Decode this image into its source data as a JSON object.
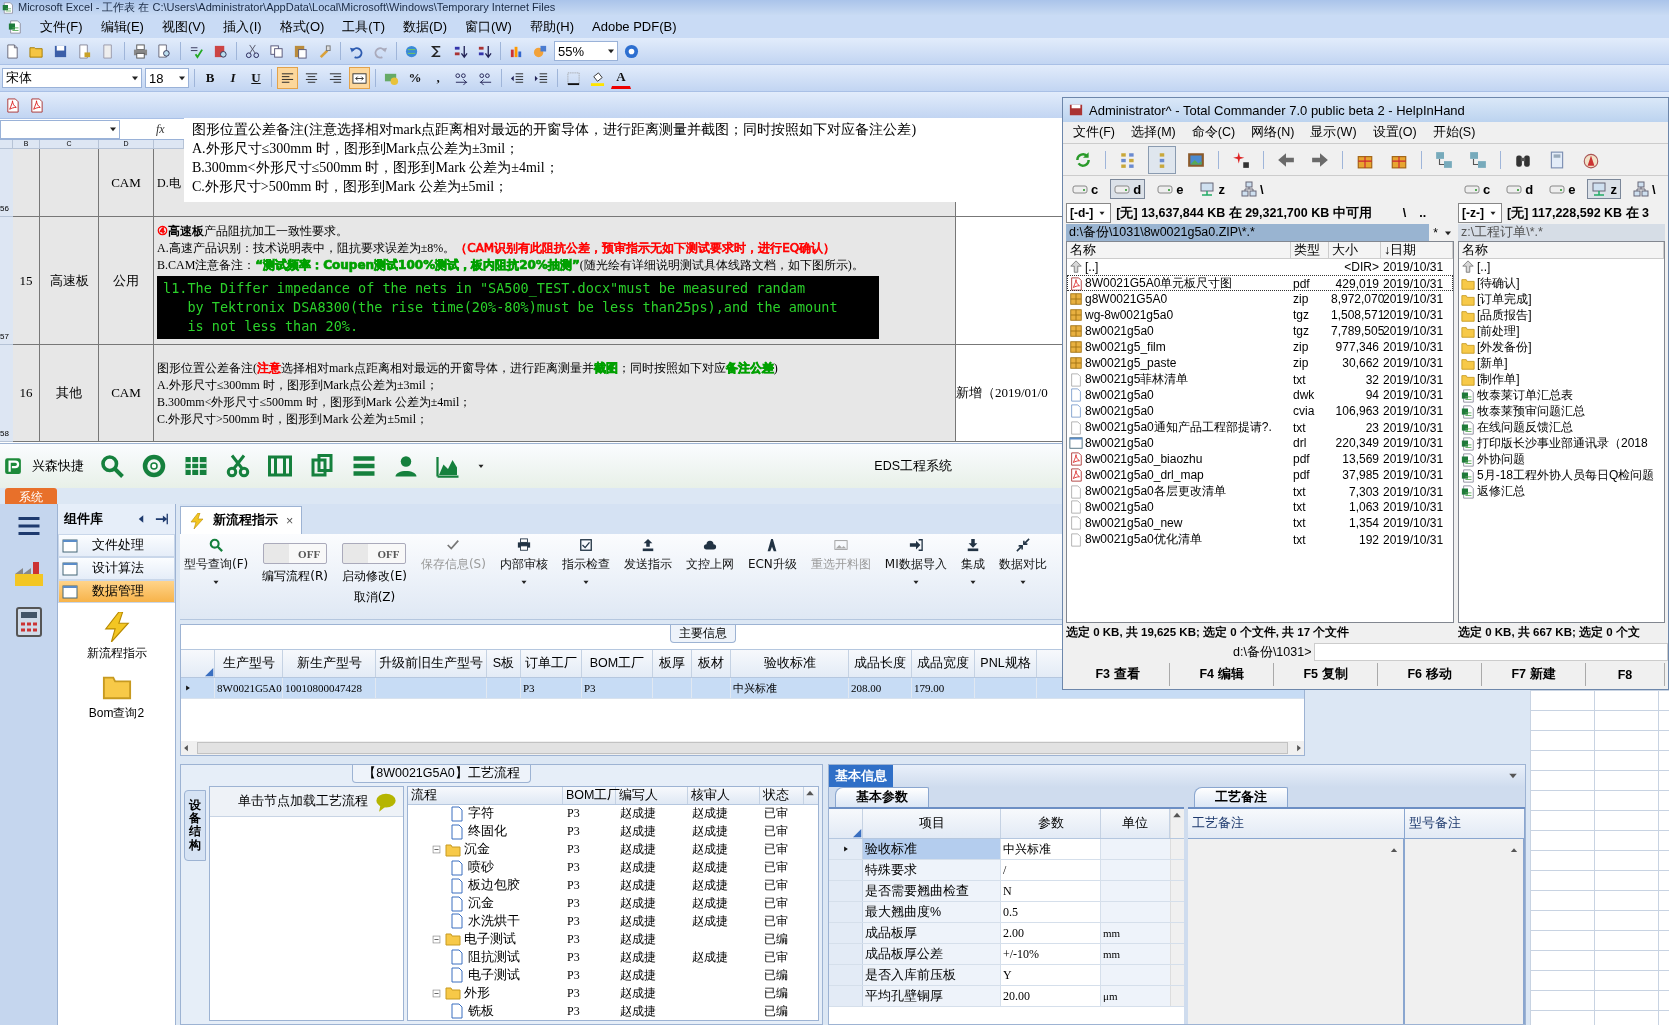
{
  "excel": {
    "title": "Microsoft Excel - 工作表 在 C:\\Users\\Administrator\\AppData\\Local\\Microsoft\\Windows\\Temporary Internet Files",
    "menu": [
      "文件(F)",
      "编辑(E)",
      "视图(V)",
      "插入(I)",
      "格式(O)",
      "工具(T)",
      "数据(D)",
      "窗口(W)",
      "帮助(H)",
      "Adobe PDF(B)"
    ],
    "zoom": "55%",
    "font": "宋体",
    "font_size": "18",
    "format_buttons": [
      {
        "label": "B",
        "kind": "bold"
      },
      {
        "label": "I",
        "kind": "italic"
      },
      {
        "label": "U",
        "kind": "underline"
      }
    ],
    "align_buttons": [
      {
        "kind": "left",
        "selected": true
      },
      {
        "kind": "center",
        "selected": false
      },
      {
        "kind": "right",
        "selected": false
      },
      {
        "kind": "merge",
        "selected": true
      }
    ],
    "number_buttons": [
      "%",
      ","
    ],
    "font_color_label": "A",
    "function_label": "fx",
    "formula_lines": [
      "图形位置公差备注(注意选择相对mark点距离相对最远的开窗导体，进行距离测量并截图；同时按照如下对应备注公差)",
      "A.外形尺寸≤300mm 时，图形到Mark点公差为±3mil；",
      "B.300mm<外形尺寸≤500mm 时，图形到Mark 公差为±4mil；",
      "C.外形尺寸>500mm 时，图形到Mark 公差为±5mil；"
    ],
    "columns": [
      "B",
      "C",
      "D"
    ],
    "rows": [
      {
        "number": "56",
        "owner": "CAM",
        "content": [
          [
            {
              "text": "D.电"
            }
          ]
        ]
      },
      {
        "number": "57",
        "no": "15",
        "category": "高速板",
        "owner": "公用",
        "content": [
          [
            {
              "text": "④",
              "color": "#ff0000"
            },
            {
              "text": "高速板",
              "bold": true
            },
            {
              "text": "产品阻抗加工一致性要求。"
            }
          ],
          [
            {
              "text": "A.高速产品识别：技术说明表中，阻抗要求误差为±8%。"
            },
            {
              "text": "（CAM识别有此阻抗公差，预审指示无如下测试要求时，进行EQ确认）",
              "color": "#ff0000"
            }
          ],
          [
            {
              "text": "B.CAM注意备注："
            },
            {
              "text": "“测试频率：Coupen测试100%测试，板内阻抗20%抽测”",
              "color": "#00a000",
              "bold": true
            },
            {
              "text": "(随光绘有详细说明测试具体线路文档，如下图所示)。"
            }
          ]
        ],
        "console": [
          "l1.The Differ impedance of the nets in \"SA500_TEST.docx\"must be measured randam",
          "   by Tektronix DSA8300(the rise time(20%-80%)must be less than25ps),and the amount",
          "   is not less than 20%."
        ]
      },
      {
        "number": "58",
        "no": "16",
        "category": "其他",
        "owner": "CAM",
        "content": [
          [
            {
              "text": "图形位置公差备注("
            },
            {
              "text": "注意",
              "color": "#ff0000"
            },
            {
              "text": "选择相对mark点距离相对最远的开窗导体，进行距离测量并"
            },
            {
              "text": "截图",
              "color": "#00a000",
              "bold": true
            },
            {
              "text": "；同时按照如下对应"
            },
            {
              "text": "备注公差",
              "color": "#00a000",
              "bold": true
            },
            {
              "text": ")"
            }
          ],
          [
            {
              "text": "A.外形尺寸≤300mm 时，图形到Mark点公差为±3mil；"
            }
          ],
          [
            {
              "text": "B.300mm<外形尺寸≤500mm 时，图形到Mark 公差为±4mil；"
            }
          ],
          [
            {
              "text": "C.外形尺寸>500mm 时，图形到Mark 公差为±5mil；"
            }
          ]
        ],
        "note": "新增（2019/01/0"
      }
    ]
  },
  "tc": {
    "title": "Administrator^ - Total Commander 7.0 public beta 2 - HelpInHand",
    "menu": [
      "文件(F)",
      "选择(M)",
      "命令(C)",
      "网络(N)",
      "显示(W)",
      "设置(O)",
      "开始(S)"
    ],
    "panels": [
      {
        "active": true,
        "drives": [
          {
            "letter": "c",
            "kind": "disk",
            "selected": false
          },
          {
            "letter": "d",
            "kind": "disk",
            "selected": true
          },
          {
            "letter": "e",
            "kind": "disk",
            "selected": false
          },
          {
            "letter": "z",
            "kind": "net",
            "selected": false
          },
          {
            "letter": "\\",
            "kind": "network",
            "selected": false
          }
        ],
        "combo": "[-d-]",
        "free_space": "[无] 13,637,844 KB 在 29,321,700 KB 中可用",
        "nav": [
          "\\",
          ".."
        ],
        "path": "d:\\备份\\1031\\8w0021g5a0.ZIP\\*.*",
        "filter": "*",
        "columns": [
          "名称",
          "类型",
          "大小",
          "↓日期"
        ],
        "files": [
          {
            "name": "[..]",
            "kind": "up",
            "size": "<DIR>",
            "date": "2019/10/31",
            "focused": false
          },
          {
            "name": "8W0021G5A0单元板尺寸图",
            "kind": "pdf",
            "type": "pdf",
            "size": "429,019",
            "date": "2019/10/31",
            "focused": true
          },
          {
            "name": "g8W0021G5A0",
            "kind": "archive",
            "type": "zip",
            "size": "8,972,070",
            "date": "2019/10/31",
            "focused": false
          },
          {
            "name": "wg-8w0021g5a0",
            "kind": "archive",
            "type": "tgz",
            "size": "1,508,571",
            "date": "2019/10/31",
            "focused": false
          },
          {
            "name": "8w0021g5a0",
            "kind": "archive",
            "type": "tgz",
            "size": "7,789,505",
            "date": "2019/10/31",
            "focused": false
          },
          {
            "name": "8w0021g5_film",
            "kind": "archive",
            "type": "zip",
            "size": "977,346",
            "date": "2019/10/31",
            "focused": false
          },
          {
            "name": "8w0021g5_paste",
            "kind": "archive",
            "type": "zip",
            "size": "30,662",
            "date": "2019/10/31",
            "focused": false
          },
          {
            "name": "8w0021g5菲林清单",
            "kind": "text",
            "type": "txt",
            "size": "32",
            "date": "2019/10/31",
            "focused": false
          },
          {
            "name": "8w0021g5a0",
            "kind": "file",
            "type": "dwk",
            "size": "94",
            "date": "2019/10/31",
            "focused": false
          },
          {
            "name": "8w0021g5a0",
            "kind": "file",
            "type": "cvia",
            "size": "106,963",
            "date": "2019/10/31",
            "focused": false
          },
          {
            "name": "8w0021g5a0通知产品工程部提请?.",
            "kind": "text",
            "type": "txt",
            "size": "23",
            "date": "2019/10/31",
            "focused": false
          },
          {
            "name": "8w0021g5a0",
            "kind": "window",
            "type": "drl",
            "size": "220,349",
            "date": "2019/10/31",
            "focused": false
          },
          {
            "name": "8w0021g5a0_biaozhu",
            "kind": "pdf",
            "type": "pdf",
            "size": "13,569",
            "date": "2019/10/31",
            "focused": false
          },
          {
            "name": "8w0021g5a0_drl_map",
            "kind": "pdf",
            "type": "pdf",
            "size": "37,985",
            "date": "2019/10/31",
            "focused": false
          },
          {
            "name": "8w0021g5a0各层更改清单",
            "kind": "text",
            "type": "txt",
            "size": "7,303",
            "date": "2019/10/31",
            "focused": false
          },
          {
            "name": "8w0021g5a0",
            "kind": "text",
            "type": "txt",
            "size": "1,063",
            "date": "2019/10/31",
            "focused": false
          },
          {
            "name": "8w0021g5a0_new",
            "kind": "text",
            "type": "txt",
            "size": "1,354",
            "date": "2019/10/31",
            "focused": false
          },
          {
            "name": "8w0021g5a0优化清单",
            "kind": "text",
            "type": "txt",
            "size": "192",
            "date": "2019/10/31",
            "focused": false
          }
        ],
        "status": "选定 0 KB, 共 19,625 KB; 选定 0 个文件, 共 17 个文件"
      },
      {
        "active": false,
        "drives": [
          {
            "letter": "c",
            "kind": "disk",
            "selected": false
          },
          {
            "letter": "d",
            "kind": "disk",
            "selected": false
          },
          {
            "letter": "e",
            "kind": "disk",
            "selected": false
          },
          {
            "letter": "z",
            "kind": "net",
            "selected": true
          },
          {
            "letter": "\\",
            "kind": "network",
            "selected": false
          }
        ],
        "combo": "[-z-]",
        "free_space": "[无] 117,228,592 KB 在 3",
        "path": "z:\\工程订单\\*.*",
        "columns": [
          "名称"
        ],
        "files": [
          {
            "name": "[..]",
            "kind": "up",
            "focused": false
          },
          {
            "name": "[待确认]",
            "kind": "folder",
            "focused": false
          },
          {
            "name": "[订单完成]",
            "kind": "folder",
            "focused": false
          },
          {
            "name": "[品质报告]",
            "kind": "folder",
            "focused": false
          },
          {
            "name": "[前处理]",
            "kind": "folder",
            "focused": false
          },
          {
            "name": "[外发备份]",
            "kind": "folder",
            "focused": false
          },
          {
            "name": "[新单]",
            "kind": "folder",
            "focused": false
          },
          {
            "name": "[制作单]",
            "kind": "folder",
            "focused": false
          },
          {
            "name": "牧泰莱订单汇总表",
            "kind": "sheet",
            "focused": false
          },
          {
            "name": "牧泰莱预审问题汇总",
            "kind": "sheet",
            "focused": false
          },
          {
            "name": "在线问题反馈汇总",
            "kind": "sheet",
            "focused": false
          },
          {
            "name": "打印版长沙事业部通讯录（2018",
            "kind": "sheet",
            "focused": false
          },
          {
            "name": "外协问题",
            "kind": "sheet",
            "focused": false
          },
          {
            "name": "5月-18工程外协人员每日Q检问题",
            "kind": "sheet",
            "focused": false
          },
          {
            "name": "返修汇总",
            "kind": "sheet",
            "focused": false
          }
        ],
        "status": "选定 0 KB, 共 667 KB; 选定 0 个文"
      }
    ],
    "command_prompt": "d:\\备份\\1031>",
    "function_keys": [
      "F3 查看",
      "F4 编辑",
      "F5 复制",
      "F6 移动",
      "F7 新建",
      "F8"
    ]
  },
  "eds": {
    "brand": "兴森快捷",
    "title": "EDS工程系统",
    "system_tab": "系统",
    "sidebar": {
      "title": "组件库",
      "items": [
        {
          "label": "文件处理",
          "selected": false
        },
        {
          "label": "设计算法",
          "selected": false
        },
        {
          "label": "数据管理",
          "selected": true
        }
      ],
      "launchers": [
        {
          "label": "新流程指示",
          "kind": "bolt"
        },
        {
          "label": "Bom查询2",
          "kind": "folder"
        }
      ]
    },
    "doc_tabs": [
      {
        "label": "新流程指示",
        "close_label": "×",
        "selected": true
      }
    ],
    "ribbon": [
      {
        "kind": "button",
        "label": "型号查询(F)",
        "disabled": false,
        "dropdown": true
      },
      {
        "kind": "toggle",
        "label": "编写流程(R)",
        "switch_text": "OFF",
        "on": false
      },
      {
        "kind": "toggle",
        "label": "启动修改(E)",
        "sublabel": "取消(Z)",
        "switch_text": "OFF",
        "on": false
      },
      {
        "kind": "button",
        "label": "保存信息(S)",
        "disabled": true,
        "dropdown": false
      },
      {
        "kind": "button",
        "label": "内部审核",
        "disabled": false,
        "dropdown": true
      },
      {
        "kind": "button",
        "label": "指示检查",
        "disabled": false,
        "dropdown": true
      },
      {
        "kind": "button",
        "label": "发送指示",
        "disabled": false,
        "dropdown": false
      },
      {
        "kind": "button",
        "label": "文控上网",
        "disabled": false,
        "dropdown": false
      },
      {
        "kind": "button",
        "label": "ECN升级",
        "disabled": false,
        "dropdown": false
      },
      {
        "kind": "button",
        "label": "重选开料图",
        "disabled": true,
        "dropdown": false
      },
      {
        "kind": "button",
        "label": "MI数据导入",
        "disabled": false,
        "dropdown": true
      },
      {
        "kind": "button",
        "label": "集成",
        "disabled": false,
        "dropdown": true
      },
      {
        "kind": "button",
        "label": "数据对比",
        "disabled": false,
        "dropdown": true
      }
    ],
    "grid": {
      "group": "主要信息",
      "columns": [
        "生产型号",
        "新生产型号",
        "升级前旧生产型号",
        "S板",
        "订单工厂",
        "BOM工厂",
        "板厚",
        "板材",
        "验收标准",
        "成品长度",
        "成品宽度",
        "PNL规格"
      ],
      "rows": [
        {
          "selected": true,
          "cells": [
            "8W0021G5A0",
            "10010800047428",
            null,
            null,
            "P3",
            "P3",
            null,
            null,
            "中兴标准",
            "208.00",
            "179.00",
            null
          ]
        }
      ]
    },
    "process": {
      "group": "【8W0021G5A0】工艺流程",
      "side_tab": "设备结构",
      "hint": "单击节点加载工艺流程",
      "columns": [
        "流程",
        "BOM工厂",
        "编写人",
        "核审人",
        "状态"
      ],
      "tree": [
        {
          "children": [
            {
              "label": "字符",
              "kind": "step",
              "bom": "P3",
              "writer": "赵成捷",
              "reviewer": "赵成捷",
              "status": "已审"
            },
            {
              "label": "终固化",
              "kind": "step",
              "bom": "P3",
              "writer": "赵成捷",
              "reviewer": "赵成捷",
              "status": "已审"
            }
          ]
        },
        {
          "label": "沉金",
          "kind": "group",
          "bom": "P3",
          "writer": "赵成捷",
          "reviewer": "赵成捷",
          "status": "已审",
          "children": [
            {
              "label": "喷砂",
              "kind": "step",
              "bom": "P3",
              "writer": "赵成捷",
              "reviewer": "赵成捷",
              "status": "已审"
            },
            {
              "label": "板边包胶",
              "kind": "step",
              "bom": "P3",
              "writer": "赵成捷",
              "reviewer": "赵成捷",
              "status": "已审"
            },
            {
              "label": "沉金",
              "kind": "step",
              "bom": "P3",
              "writer": "赵成捷",
              "reviewer": "赵成捷",
              "status": "已审"
            },
            {
              "label": "水洗烘干",
              "kind": "step",
              "bom": "P3",
              "writer": "赵成捷",
              "reviewer": "赵成捷",
              "status": "已审"
            }
          ]
        },
        {
          "label": "电子测试",
          "kind": "group",
          "bom": "P3",
          "writer": "赵成捷",
          "status": "已编",
          "children": [
            {
              "label": "阻抗测试",
              "kind": "step",
              "bom": "P3",
              "writer": "赵成捷",
              "reviewer": "赵成捷",
              "status": "已审"
            },
            {
              "label": "电子测试",
              "kind": "step",
              "bom": "P3",
              "writer": "赵成捷",
              "status": "已编"
            }
          ]
        },
        {
          "label": "外形",
          "kind": "group",
          "bom": "P3",
          "writer": "赵成捷",
          "status": "已编",
          "children": [
            {
              "label": "铣板",
              "kind": "step",
              "bom": "P3",
              "writer": "赵成捷",
              "status": "已编"
            }
          ]
        }
      ]
    },
    "info": {
      "tab": "基本信息",
      "params_tab": "基本参数",
      "columns": [
        "项目",
        "参数",
        "单位"
      ],
      "rows": [
        {
          "item": "验收标准",
          "value": "中兴标准",
          "selected": true
        },
        {
          "item": "特殊要求",
          "value": "/",
          "selected": false
        },
        {
          "item": "是否需要翘曲检查",
          "value": "N",
          "selected": false
        },
        {
          "item": "最大翘曲度%",
          "value": "0.5",
          "selected": false
        },
        {
          "item": "成品板厚",
          "value": "2.00",
          "unit": "mm",
          "selected": false
        },
        {
          "item": "成品板厚公差",
          "value": "+/-10%",
          "unit": "mm",
          "selected": false
        },
        {
          "item": "是否入库前压板",
          "value": "Y",
          "selected": false
        },
        {
          "item": "平均孔壁铜厚",
          "value": "20.00",
          "unit": "μm",
          "selected": false
        }
      ],
      "notes_tab": "工艺备注",
      "notes_columns": [
        "工艺备注",
        "型号备注"
      ]
    }
  }
}
